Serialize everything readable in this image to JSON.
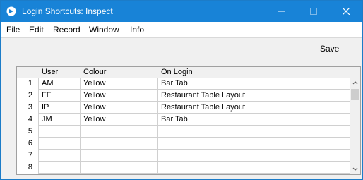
{
  "window": {
    "title": "Login Shortcuts: Inspect",
    "accent_color": "#1883d7"
  },
  "menu": [
    {
      "label": "File"
    },
    {
      "label": "Edit"
    },
    {
      "label": "Record"
    },
    {
      "label": "Window"
    },
    {
      "label": "Info"
    }
  ],
  "toolbar": {
    "save_label": "Save"
  },
  "grid": {
    "headers": {
      "user": "User",
      "colour": "Colour",
      "on_login": "On Login"
    },
    "rows": [
      {
        "num": "1",
        "user": "AM",
        "colour": "Yellow",
        "on_login": "Bar Tab"
      },
      {
        "num": "2",
        "user": "FF",
        "colour": "Yellow",
        "on_login": "Restaurant Table Layout"
      },
      {
        "num": "3",
        "user": "IP",
        "colour": "Yellow",
        "on_login": "Restaurant Table Layout"
      },
      {
        "num": "4",
        "user": "JM",
        "colour": "Yellow",
        "on_login": "Bar Tab"
      },
      {
        "num": "5",
        "user": "",
        "colour": "",
        "on_login": ""
      },
      {
        "num": "6",
        "user": "",
        "colour": "",
        "on_login": ""
      },
      {
        "num": "7",
        "user": "",
        "colour": "",
        "on_login": ""
      },
      {
        "num": "8",
        "user": "",
        "colour": "",
        "on_login": ""
      }
    ]
  }
}
